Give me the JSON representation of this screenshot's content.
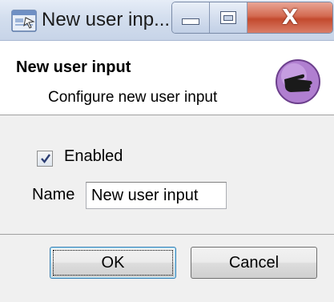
{
  "window": {
    "title": "New user inp...",
    "controls": {
      "minimize_icon": "minimize-icon",
      "maximize_icon": "maximize-icon",
      "close_glyph": "X"
    }
  },
  "header": {
    "title": "New user input",
    "subtitle": "Configure new user input",
    "icon": "pointing-hand-icon",
    "icon_colors": {
      "circle": "#b07fd0",
      "hand": "#1a1a1a"
    }
  },
  "form": {
    "enabled": {
      "label": "Enabled",
      "checked": true
    },
    "name": {
      "label": "Name",
      "value": "New user input"
    }
  },
  "buttons": {
    "ok": "OK",
    "cancel": "Cancel"
  }
}
